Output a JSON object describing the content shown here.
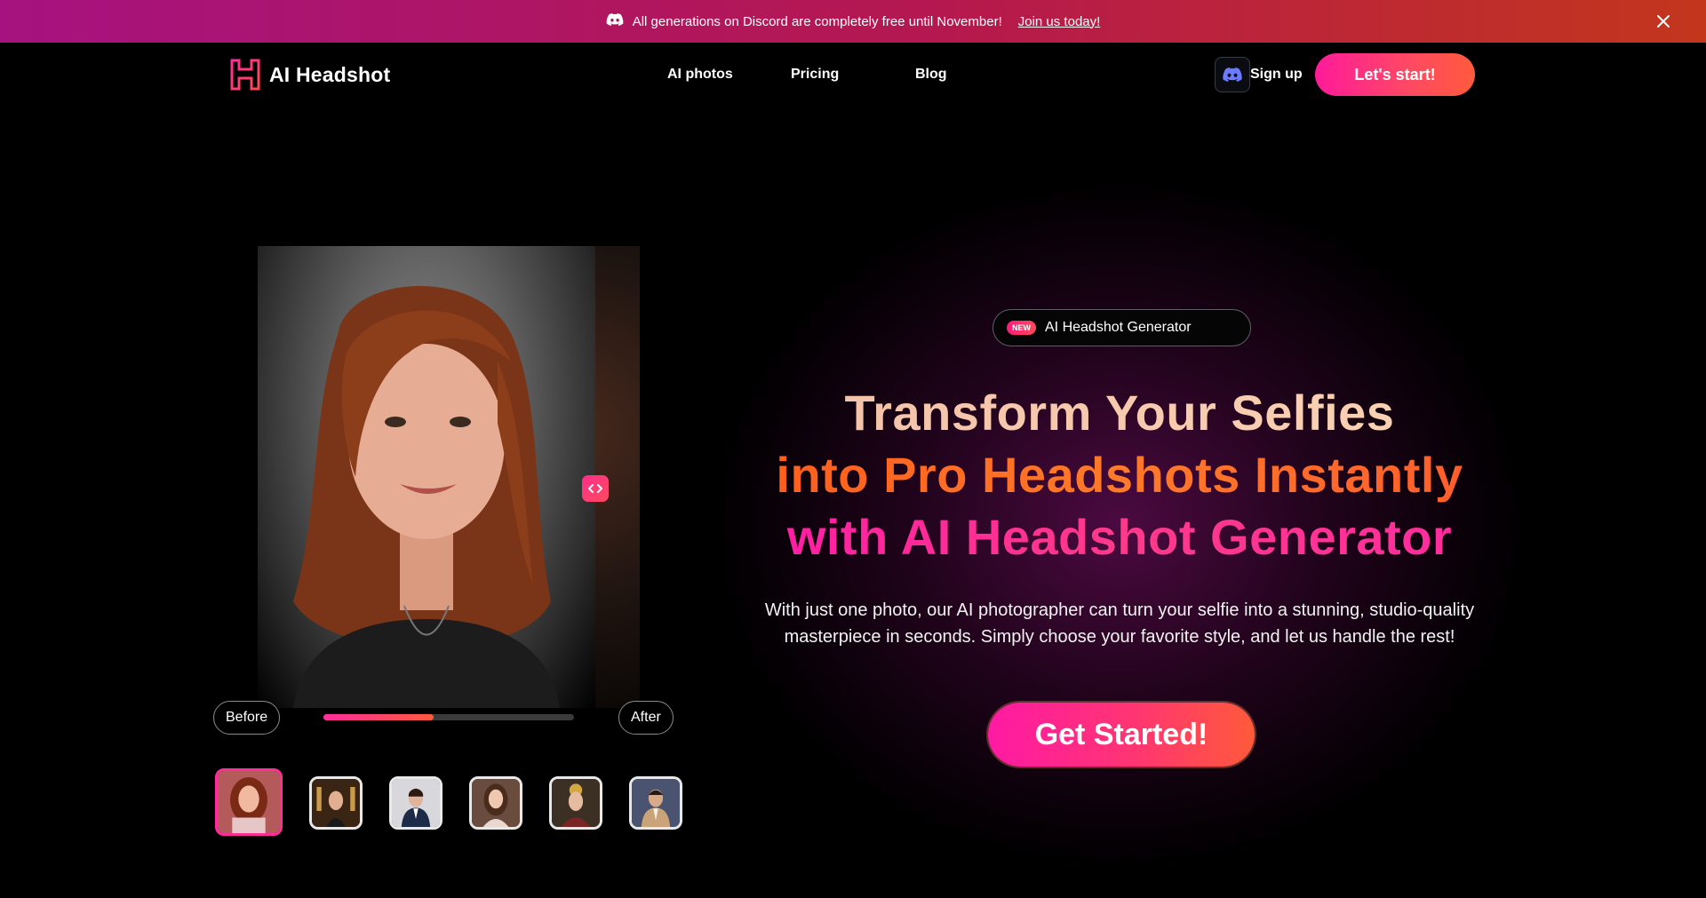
{
  "announcement": {
    "text": "All generations on Discord are completely free until November!",
    "link_label": "Join us today!",
    "icons": [
      "discord-icon",
      "close-icon"
    ]
  },
  "header": {
    "logo_text": "AI Headshot",
    "nav": [
      "AI photos",
      "Pricing",
      "Blog"
    ],
    "signup_label": "Sign up",
    "cta_label": "Let's start!"
  },
  "comparison": {
    "before_label": "Before",
    "after_label": "After",
    "progress": 0.44,
    "selected_thumbnail": 0,
    "thumbnail_count": 6
  },
  "hero": {
    "badge_new": "NEW",
    "badge_label": "AI Headshot Generator",
    "headline_line1": "Transform Your Selfies",
    "headline_line2": "into Pro Headshots Instantly",
    "headline_line3": "with AI Headshot Generator",
    "subtitle": "With just one photo, our AI photographer can turn your selfie into a stunning, studio-quality masterpiece in seconds. Simply choose your favorite style, and let us handle the rest!",
    "cta_label": "Get Started!"
  },
  "colors": {
    "accent_pink": "#ff1a9a",
    "accent_orange": "#ff5a3c",
    "headline_peach": "#f6c8ad"
  }
}
